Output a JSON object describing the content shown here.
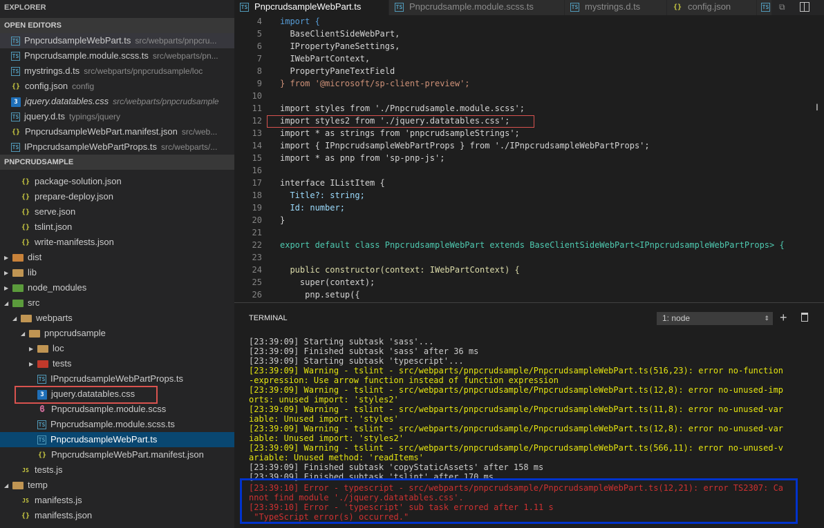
{
  "sidebar": {
    "explorer_title": "EXPLORER",
    "open_editors_title": "OPEN EDITORS",
    "project_title": "PNPCRUDSAMPLE",
    "open_editors": [
      {
        "name": "PnpcrudsampleWebPart.ts",
        "path": "src/webparts/pnpcru...",
        "icon": "ts-icon"
      },
      {
        "name": "Pnpcrudsample.module.scss.ts",
        "path": "src/webparts/pn...",
        "icon": "ts-icon"
      },
      {
        "name": "mystrings.d.ts",
        "path": "src/webparts/pnpcrudsample/loc",
        "icon": "ts-icon"
      },
      {
        "name": "config.json",
        "path": "config",
        "icon": "json-icon"
      },
      {
        "name": "jquery.datatables.css",
        "path": "src/webparts/pnpcrudsample",
        "icon": "css-icon"
      },
      {
        "name": "jquery.d.ts",
        "path": "typings/jquery",
        "icon": "ts-icon"
      },
      {
        "name": "PnpcrudsampleWebPart.manifest.json",
        "path": "src/web...",
        "icon": "json-icon"
      },
      {
        "name": "IPnpcrudsampleWebPartProps.ts",
        "path": "src/webparts/...",
        "icon": "ts-icon"
      }
    ],
    "tree": [
      {
        "label": "package-solution.json"
      },
      {
        "label": "prepare-deploy.json"
      },
      {
        "label": "serve.json"
      },
      {
        "label": "tslint.json"
      },
      {
        "label": "write-manifests.json"
      },
      {
        "label": "dist"
      },
      {
        "label": "lib"
      },
      {
        "label": "node_modules"
      },
      {
        "label": "src"
      },
      {
        "label": "webparts"
      },
      {
        "label": "pnpcrudsample"
      },
      {
        "label": "loc"
      },
      {
        "label": "tests"
      },
      {
        "label": "IPnpcrudsampleWebPartProps.ts"
      },
      {
        "label": "jquery.datatables.css"
      },
      {
        "label": "Pnpcrudsample.module.scss"
      },
      {
        "label": "Pnpcrudsample.module.scss.ts"
      },
      {
        "label": "PnpcrudsampleWebPart.ts"
      },
      {
        "label": "PnpcrudsampleWebPart.manifest.json"
      },
      {
        "label": "tests.js"
      },
      {
        "label": "temp"
      },
      {
        "label": "manifests.js"
      },
      {
        "label": "manifests.json"
      }
    ]
  },
  "tabs": [
    {
      "label": "PnpcrudsampleWebPart.ts",
      "icon": "ts-icon",
      "active": true
    },
    {
      "label": "Pnpcrudsample.module.scss.ts",
      "icon": "ts-icon"
    },
    {
      "label": "mystrings.d.ts",
      "icon": "ts-icon"
    },
    {
      "label": "config.json",
      "icon": "json-icon"
    }
  ],
  "editor": {
    "line_numbers": [
      "4",
      "5",
      "6",
      "7",
      "8",
      "9",
      "10",
      "11",
      "12",
      "13",
      "14",
      "15",
      "16",
      "17",
      "18",
      "19",
      "20",
      "21",
      "22",
      "23",
      "24",
      "25",
      "26"
    ],
    "lines": [
      "import {",
      "  BaseClientSideWebPart,",
      "  IPropertyPaneSettings,",
      "  IWebPartContext,",
      "  PropertyPaneTextField",
      "} from '@microsoft/sp-client-preview';",
      "",
      "import styles from './Pnpcrudsample.module.scss';",
      "import styles2 from './jquery.datatables.css';",
      "import * as strings from 'pnpcrudsampleStrings';",
      "import { IPnpcrudsampleWebPartProps } from './IPnpcrudsampleWebPartProps';",
      "import * as pnp from 'sp-pnp-js';",
      "",
      "interface IListItem {",
      "  Title?: string;",
      "  Id: number;",
      "}",
      "",
      "export default class PnpcrudsampleWebPart extends BaseClientSideWebPart<IPnpcrudsampleWebPartProps> {",
      "",
      "  public constructor(context: IWebPartContext) {",
      "    super(context);",
      "     pnp.setup({"
    ]
  },
  "terminal": {
    "title": "TERMINAL",
    "selector": "1: node",
    "lines": [
      "[23:39:09] Starting subtask 'sass'...",
      "[23:39:09] Finished subtask 'sass' after 36 ms",
      "[23:39:09] Starting subtask 'typescript'...",
      "[23:39:09] Warning - tslint - src/webparts/pnpcrudsample/PnpcrudsampleWebPart.ts(516,23): error no-function",
      "-expression: Use arrow function instead of function expression",
      "[23:39:09] Warning - tslint - src/webparts/pnpcrudsample/PnpcrudsampleWebPart.ts(12,8): error no-unused-imp",
      "orts: unused import: 'styles2'",
      "[23:39:09] Warning - tslint - src/webparts/pnpcrudsample/PnpcrudsampleWebPart.ts(11,8): error no-unused-var",
      "iable: Unused import: 'styles'",
      "[23:39:09] Warning - tslint - src/webparts/pnpcrudsample/PnpcrudsampleWebPart.ts(12,8): error no-unused-var",
      "iable: Unused import: 'styles2'",
      "[23:39:09] Warning - tslint - src/webparts/pnpcrudsample/PnpcrudsampleWebPart.ts(566,11): error no-unused-v",
      "ariable: Unused method: 'readItems'",
      "[23:39:09] Finished subtask 'copyStaticAssets' after 158 ms",
      "[23:39:09] Finished subtask 'tslint' after 170 ms",
      "[23:39:10] Error - typescript - src/webparts/pnpcrudsample/PnpcrudsampleWebPart.ts(12,21): error TS2307: Ca",
      "nnot find module './jquery.datatables.css'.",
      "[23:39:10] Error - 'typescript' sub task errored after 1.11 s",
      " \"TypeScript error(s) occurred.\""
    ]
  },
  "colors": {
    "sidebar_bg": "#252526",
    "editor_bg": "#1e1e1e",
    "selection": "#094771",
    "red_box": "#d9534f",
    "blue_box": "#0033cc"
  }
}
